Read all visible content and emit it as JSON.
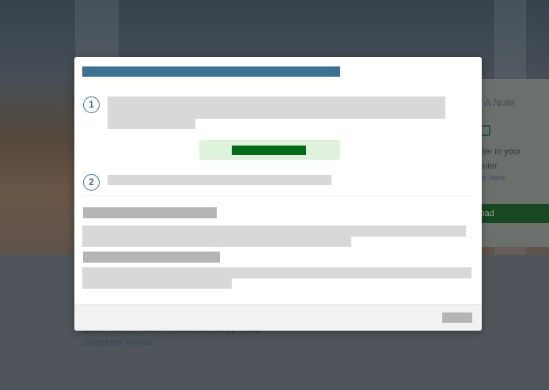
{
  "background": {
    "card_title": "A Note",
    "card_line_1": "ster in your",
    "card_line_2": "puter",
    "card_link": "e here",
    "card_button": "load",
    "lower_text": "Check to see which models are supported.",
    "lower_link": "Supported Models"
  },
  "modal": {
    "step_1": "1",
    "step_2": "2"
  }
}
